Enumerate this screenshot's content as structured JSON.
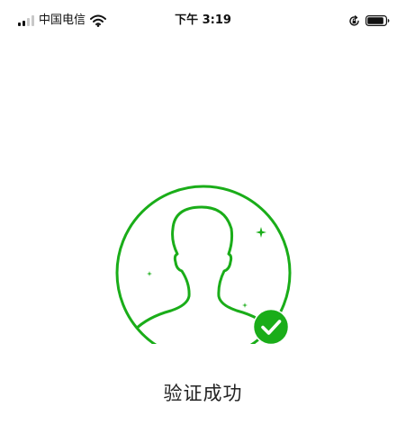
{
  "status_bar": {
    "carrier": "中国电信",
    "time": "下午 3:19",
    "signal_bars_active": 2,
    "signal_bars_total": 4,
    "battery_level_fraction": 0.9,
    "icons": {
      "wifi": "wifi-icon",
      "rotation_lock": "rotation-lock-icon",
      "battery": "battery-icon"
    }
  },
  "verification": {
    "result_text": "验证成功",
    "status": "success",
    "illustration": "user-silhouette-icon",
    "badge_icon": "check-circle-icon"
  },
  "colors": {
    "accent": "#1aad19",
    "text": "#222222",
    "background": "#ffffff"
  }
}
